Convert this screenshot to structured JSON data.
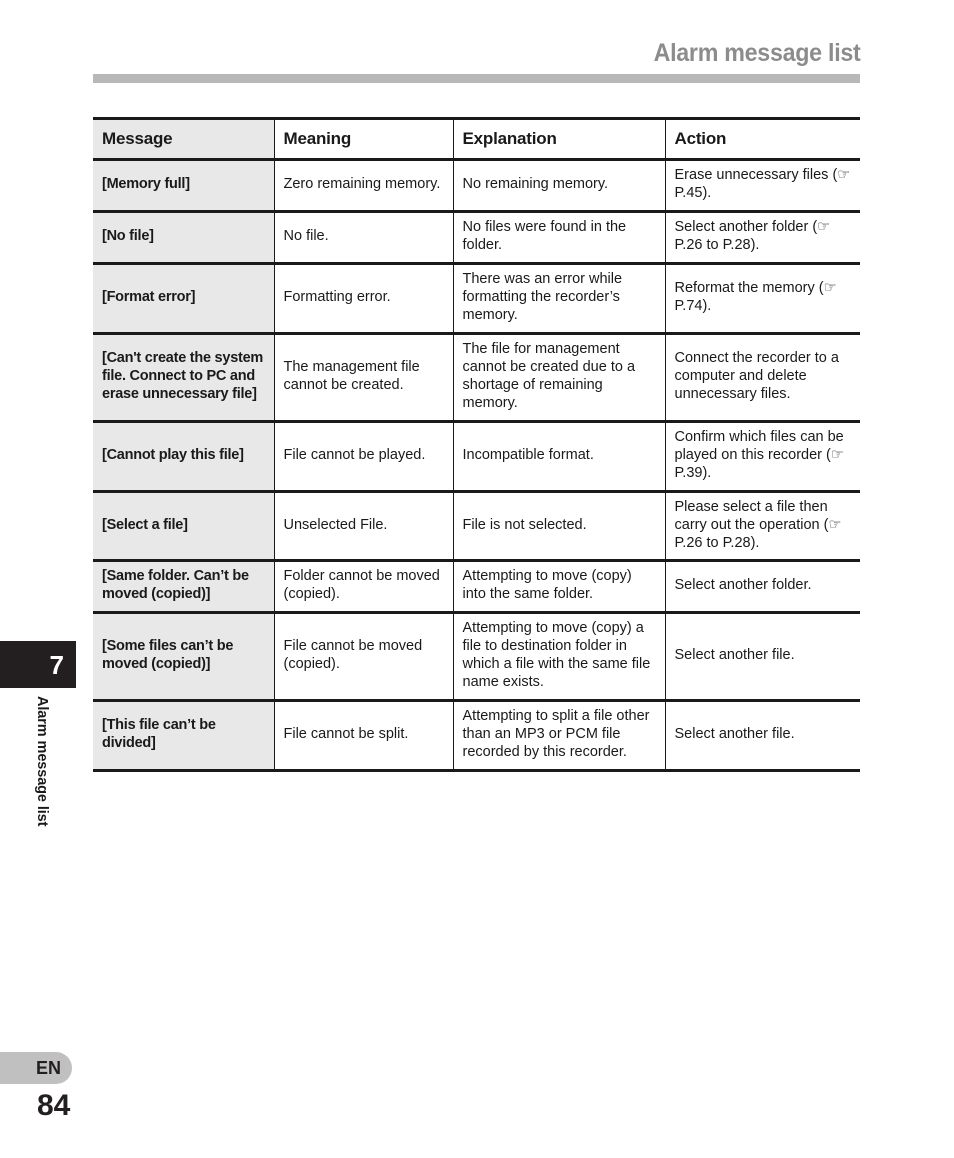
{
  "header": {
    "title": "Alarm message list"
  },
  "table": {
    "columns": [
      "Message",
      "Meaning",
      "Explanation",
      "Action"
    ],
    "rows": [
      {
        "message": "[Memory full]",
        "meaning": "Zero remaining memory.",
        "explanation": "No remaining memory.",
        "action": "Erase unnecessary files (☞ P.45)."
      },
      {
        "message": "[No file]",
        "meaning": "No file.",
        "explanation": "No files were found in the folder.",
        "action": "Select another folder (☞ P.26 to P.28)."
      },
      {
        "message": "[Format error]",
        "meaning": "Formatting error.",
        "explanation": "There was an error while formatting the recorder’s memory.",
        "action": "Reformat the memory (☞ P.74)."
      },
      {
        "message": "[Can't create the system file. Connect to PC and erase unnecessary file]",
        "meaning": "The management file cannot be created.",
        "explanation": "The file for management cannot be created due to a shortage of remaining memory.",
        "action": "Connect the recorder to a computer and delete unnecessary files."
      },
      {
        "message": "[Cannot play this file]",
        "meaning": "File cannot be played.",
        "explanation": "Incompatible format.",
        "action": "Confirm which files can be played on this recorder (☞ P.39)."
      },
      {
        "message": "[Select a file]",
        "meaning": "Unselected File.",
        "explanation": "File is not selected.",
        "action": "Please select a file then carry out the operation (☞ P.26 to P.28)."
      },
      {
        "message": "[Same folder. Can’t be moved (copied)]",
        "meaning": "Folder cannot be moved (copied).",
        "explanation": "Attempting to move (copy) into the same folder.",
        "action": "Select another folder."
      },
      {
        "message": "[Some files can’t be moved (copied)]",
        "meaning": "File cannot be moved (copied).",
        "explanation": "Attempting to move (copy) a file to destination folder in which a file with the same file name exists.",
        "action": "Select another file."
      },
      {
        "message": "[This file can’t be divided]",
        "meaning": "File cannot be split.",
        "explanation": "Attempting to split a file other than an MP3 or PCM file recorded by this recorder.",
        "action": "Select another file."
      }
    ]
  },
  "chapter": {
    "number": "7",
    "side_label": "Alarm message list"
  },
  "footer": {
    "language": "EN",
    "page_number": "84"
  },
  "colors": {
    "title_gray": "#8c8c8c",
    "rule_gray": "#b8b8b8",
    "column_shade": "#e8e8e8",
    "tab_black": "#231f20",
    "badge_gray": "#c0c0c0"
  }
}
